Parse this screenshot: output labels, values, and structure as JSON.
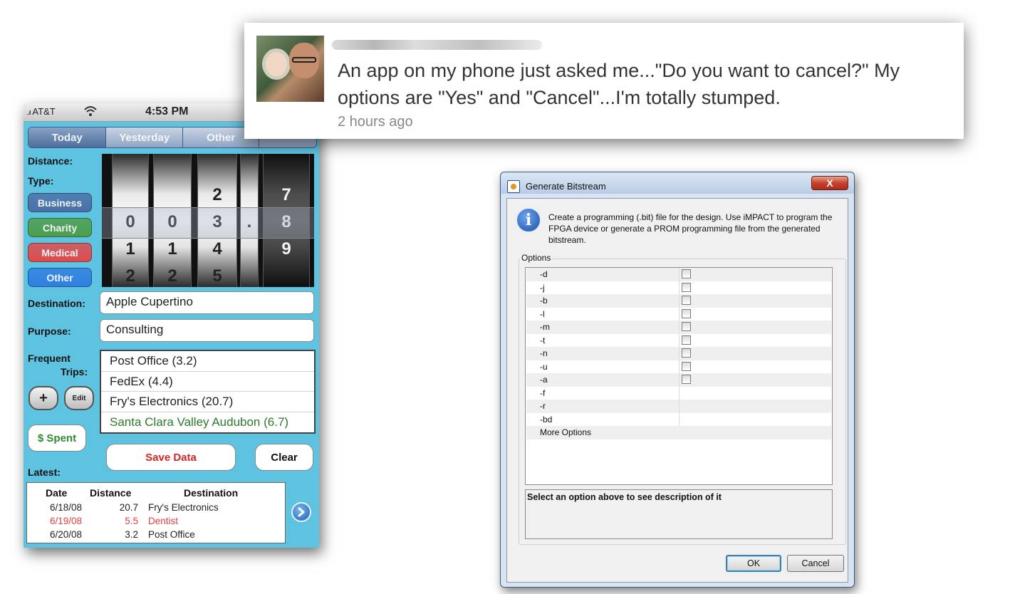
{
  "phone": {
    "status": {
      "signal": "..ıl",
      "carrier": "AT&T",
      "time": "4:53 PM"
    },
    "segments": [
      "Today",
      "Yesterday",
      "Other",
      ""
    ],
    "labels": {
      "distance": "Distance:",
      "type": "Type:",
      "destination": "Destination:",
      "purpose": "Purpose:",
      "frequent": "Frequent",
      "trips": "Trips:",
      "latest": "Latest:"
    },
    "type_buttons": [
      {
        "label": "Business",
        "color": "#4a6fa7"
      },
      {
        "label": "Charity",
        "color": "#4d9d4a"
      },
      {
        "label": "Medical",
        "color": "#e2494a"
      },
      {
        "label": "Other",
        "color": "#2f7ee0"
      }
    ],
    "odometer": {
      "columns": [
        {
          "above": "",
          "selected": "0",
          "below": "1",
          "below2": "2"
        },
        {
          "above": "",
          "selected": "0",
          "below": "1",
          "below2": "2"
        },
        {
          "above": "2",
          "selected": "3",
          "below": "4",
          "below2": "5"
        },
        {
          "above": "",
          "selected": ".",
          "below": "",
          "below2": ""
        },
        {
          "above": "7",
          "selected": "8",
          "below": "9",
          "below2": ""
        }
      ]
    },
    "destination_value": "Apple Cupertino",
    "purpose_value": "Consulting",
    "frequent_trips": [
      "Post Office (3.2)",
      "FedEx (4.4)",
      "Fry's Electronics (20.7)",
      "Santa Clara Valley Audubon (6.7)"
    ],
    "buttons": {
      "add": "+",
      "edit": "Edit",
      "spent": "$ Spent",
      "save": "Save Data",
      "clear": "Clear"
    },
    "latest_table": {
      "headers": [
        "Date",
        "Distance",
        "Destination"
      ],
      "rows": [
        {
          "date": "6/18/08",
          "distance": "20.7",
          "destination": "Fry's Electronics"
        },
        {
          "date": "6/19/08",
          "distance": "5.5",
          "destination": "Dentist"
        },
        {
          "date": "6/20/08",
          "distance": "3.2",
          "destination": "Post Office"
        }
      ]
    }
  },
  "tweet": {
    "text": "An app on my phone just asked me...\"Do you want to cancel?\" My options are \"Yes\" and \"Cancel\"...I'm totally stumped.",
    "time": "2 hours ago"
  },
  "dialog": {
    "title": "Generate Bitstream",
    "close_label": "X",
    "info_text": "Create a programming (.bit) file for the design. Use iMPACT to program the FPGA device or generate a PROM programming file from the generated bitstream.",
    "options_label": "Options",
    "options": [
      {
        "name": "-d",
        "checkbox": true
      },
      {
        "name": "-j",
        "checkbox": true
      },
      {
        "name": "-b",
        "checkbox": true
      },
      {
        "name": "-l",
        "checkbox": true
      },
      {
        "name": "-m",
        "checkbox": true
      },
      {
        "name": "-t",
        "checkbox": true
      },
      {
        "name": "-n",
        "checkbox": true
      },
      {
        "name": "-u",
        "checkbox": true
      },
      {
        "name": "-a",
        "checkbox": true
      },
      {
        "name": "-f",
        "checkbox": false
      },
      {
        "name": "-r",
        "checkbox": false
      },
      {
        "name": "-bd",
        "checkbox": false
      },
      {
        "name": "More Options",
        "checkbox": false
      }
    ],
    "description": "Select an option above to see description of it",
    "ok_label": "OK",
    "cancel_label": "Cancel"
  }
}
